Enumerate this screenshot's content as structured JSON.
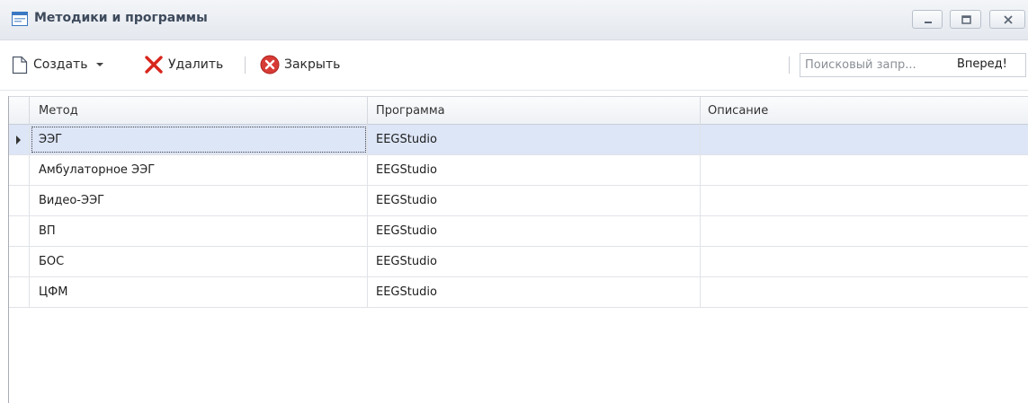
{
  "window": {
    "title": "Методики и программы",
    "icon": "window-icon"
  },
  "toolbar": {
    "create_label": "Создать",
    "delete_label": "Удалить",
    "close_label": "Закрыть",
    "search_placeholder": "Поисковый запр...",
    "search_button_label": "Вперед!"
  },
  "grid": {
    "columns": [
      "Метод",
      "Программа",
      "Описание"
    ],
    "rows": [
      {
        "method": "ЭЭГ",
        "program": "EEGStudio",
        "description": ""
      },
      {
        "method": "Амбулаторное ЭЭГ",
        "program": "EEGStudio",
        "description": ""
      },
      {
        "method": "Видео-ЭЭГ",
        "program": "EEGStudio",
        "description": ""
      },
      {
        "method": "ВП",
        "program": "EEGStudio",
        "description": ""
      },
      {
        "method": "БОС",
        "program": "EEGStudio",
        "description": ""
      },
      {
        "method": "ЦФМ",
        "program": "EEGStudio",
        "description": ""
      }
    ],
    "selected_row": 0
  },
  "colors": {
    "selection": "#dde6f7",
    "delete_icon": "#d8261c",
    "close_icon": "#d83b35"
  }
}
